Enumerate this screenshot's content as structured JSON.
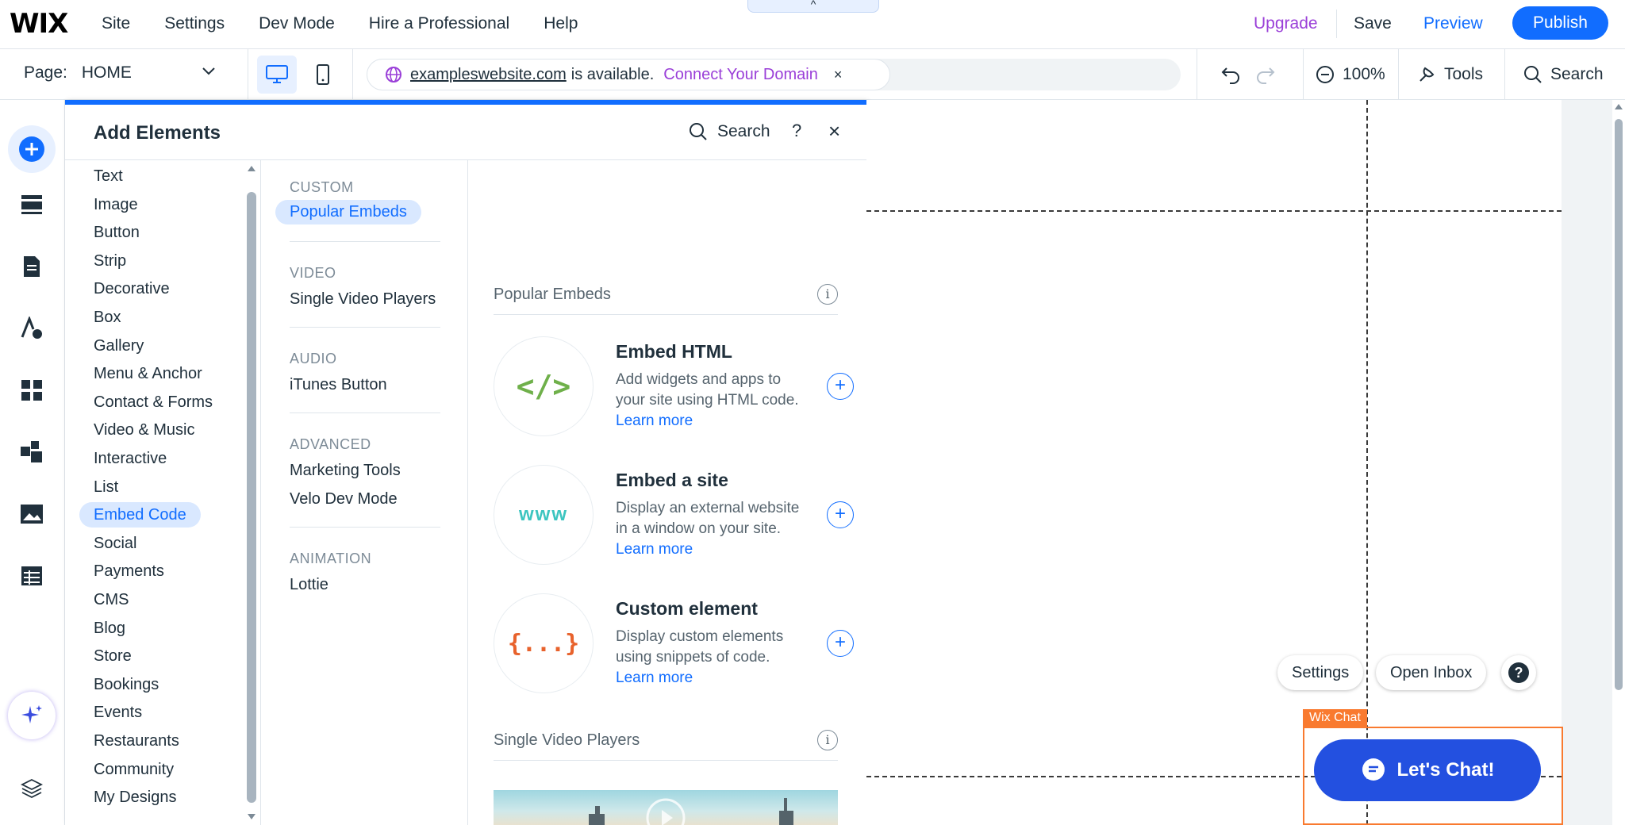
{
  "topbar": {
    "logo": "WIX",
    "menu": [
      "Site",
      "Settings",
      "Dev Mode",
      "Hire a Professional",
      "Help"
    ],
    "handle": "^",
    "upgrade": "Upgrade",
    "save": "Save",
    "preview": "Preview",
    "publish": "Publish"
  },
  "toolbar": {
    "page_label": "Page:",
    "page_value": "HOME",
    "domain": "exampleswebsite.com",
    "available": "is available.",
    "connect": "Connect Your Domain",
    "close": "×",
    "zoom": "100%",
    "tools": "Tools",
    "search": "Search"
  },
  "panel": {
    "title": "Add Elements",
    "search": "Search",
    "help": "?",
    "close": "×",
    "categories": [
      "Text",
      "Image",
      "Button",
      "Strip",
      "Decorative",
      "Box",
      "Gallery",
      "Menu & Anchor",
      "Contact & Forms",
      "Video & Music",
      "Interactive",
      "List",
      "Embed Code",
      "Social",
      "Payments",
      "CMS",
      "Blog",
      "Store",
      "Bookings",
      "Events",
      "Restaurants",
      "Community",
      "My Designs"
    ],
    "selected_category": "Embed Code",
    "sub": {
      "custom_head": "CUSTOM",
      "popular": "Popular Embeds",
      "video_head": "VIDEO",
      "single_video": "Single Video Players",
      "audio_head": "AUDIO",
      "itunes": "iTunes Button",
      "advanced_head": "ADVANCED",
      "marketing": "Marketing Tools",
      "velo": "Velo Dev Mode",
      "animation_head": "ANIMATION",
      "lottie": "Lottie"
    },
    "content": {
      "section1": "Popular Embeds",
      "section2": "Single Video Players",
      "info": "i",
      "learn_more": "Learn more",
      "cards": [
        {
          "thumb": "</>",
          "title": "Embed HTML",
          "desc": "Add widgets and apps to your site using HTML code.",
          "color": "#6fb04a"
        },
        {
          "thumb": "www",
          "title": "Embed a site",
          "desc": "Display an external website in a window on your site.",
          "color": "#3cc5c0"
        },
        {
          "thumb": "{...}",
          "title": "Custom element",
          "desc": "Display custom elements using snippets of code.",
          "color": "#e8622c"
        }
      ]
    }
  },
  "canvas": {
    "settings": "Settings",
    "open_inbox": "Open Inbox",
    "wix_chat": "Wix Chat",
    "lets_chat": "Let's Chat!"
  },
  "colors": {
    "accent": "#116dff",
    "upgrade": "#9a3fd8",
    "chat": "#2350e0",
    "chat_frame": "#f97a2f"
  }
}
